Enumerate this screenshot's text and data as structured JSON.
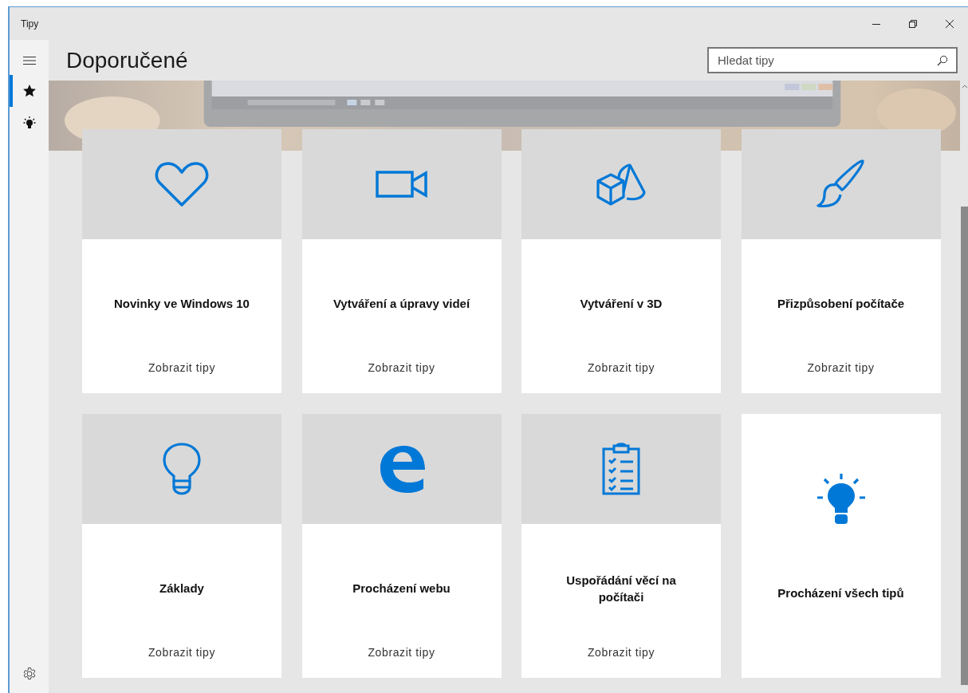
{
  "window": {
    "title": "Tipy"
  },
  "sidebar": {
    "items": [
      {
        "kind": "star",
        "selected": true
      },
      {
        "kind": "bulb",
        "selected": false
      }
    ]
  },
  "header": {
    "title": "Doporučené"
  },
  "search": {
    "placeholder": "Hledat tipy"
  },
  "cards": [
    {
      "kind": "tip",
      "title": "Novinky ve Windows 10",
      "action": "Zobrazit tipy"
    },
    {
      "kind": "tip",
      "title": "Vytváření a úpravy videí",
      "action": "Zobrazit tipy"
    },
    {
      "kind": "tip",
      "title": "Vytváření v 3D",
      "action": "Zobrazit tipy"
    },
    {
      "kind": "tip",
      "title": "Přizpůsobení počítače",
      "action": "Zobrazit tipy"
    },
    {
      "kind": "tip",
      "title": "Základy",
      "action": "Zobrazit tipy"
    },
    {
      "kind": "tip",
      "title": "Procházení webu",
      "action": "Zobrazit tipy"
    },
    {
      "kind": "tip",
      "title": "Uspořádání věcí na počítači",
      "action": "Zobrazit tipy"
    },
    {
      "kind": "browse",
      "title": "Procházení všech tipů"
    }
  ]
}
